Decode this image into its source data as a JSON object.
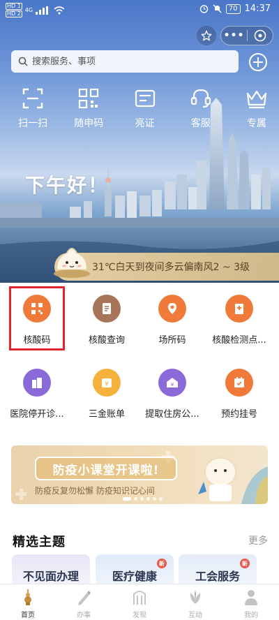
{
  "status_bar": {
    "sim1": "HD 1",
    "sim2": "HD 2",
    "network": "4G",
    "battery": "70",
    "time": "14:37"
  },
  "capsule": {
    "more": "•••"
  },
  "search": {
    "placeholder": "搜索服务、事项"
  },
  "quick_actions": [
    {
      "label": "扫一扫",
      "icon": "scan-icon"
    },
    {
      "label": "随申码",
      "icon": "qr-code-icon"
    },
    {
      "label": "亮证",
      "icon": "id-card-icon"
    },
    {
      "label": "客服",
      "icon": "headset-icon"
    },
    {
      "label": "专属",
      "icon": "crown-icon"
    }
  ],
  "greeting": "下午好！",
  "weather": "31℃白天到夜间多云偏南风2 ~ 3级",
  "services": [
    {
      "label": "核酸码",
      "icon": "qr-code-icon",
      "color": "#f07a3a"
    },
    {
      "label": "核酸查询",
      "icon": "document-icon",
      "color": "#a8745a"
    },
    {
      "label": "场所码",
      "icon": "location-pin-icon",
      "color": "#f07a3a"
    },
    {
      "label": "核酸检测点...",
      "icon": "hospital-icon",
      "color": "#f07a3a"
    },
    {
      "label": "医院停开诊...",
      "icon": "building-icon",
      "color": "#8a6ad8"
    },
    {
      "label": "三金账单",
      "icon": "money-icon",
      "color": "#f4b23c"
    },
    {
      "label": "提取住房公...",
      "icon": "house-fund-icon",
      "color": "#8a6ad8"
    },
    {
      "label": "预约挂号",
      "icon": "calendar-icon",
      "color": "#f07a3a"
    }
  ],
  "banner": {
    "title": "防疫小课堂开课啦!",
    "subtitle": "防疫反复勿松懈 防疫知识记心间"
  },
  "featured": {
    "title": "精选主题",
    "more": "更多",
    "cards": [
      {
        "label": "不见面办理",
        "badge": ""
      },
      {
        "label": "医疗健康",
        "badge": "新"
      },
      {
        "label": "工会服务",
        "badge": "新"
      }
    ]
  },
  "tabbar": [
    {
      "label": "首页",
      "active": true
    },
    {
      "label": "办事",
      "active": false
    },
    {
      "label": "发现",
      "active": false
    },
    {
      "label": "互动",
      "active": false
    },
    {
      "label": "我的",
      "active": false
    }
  ]
}
